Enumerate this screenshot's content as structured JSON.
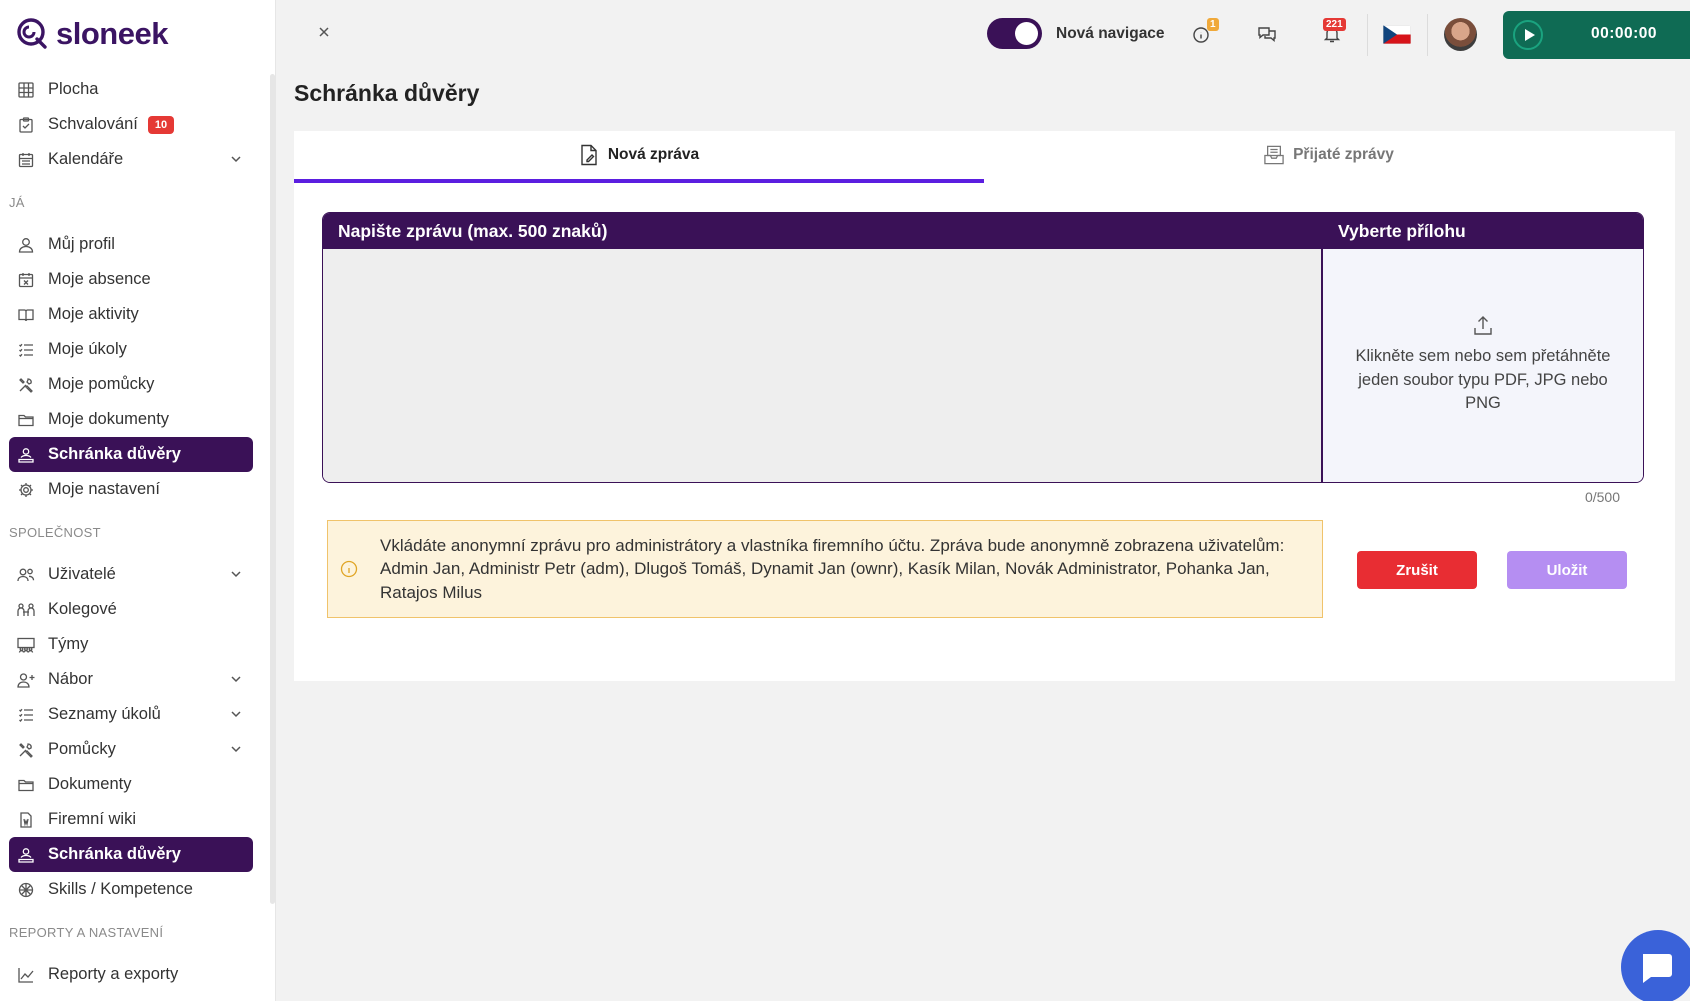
{
  "brand": {
    "name": "sloneek"
  },
  "sidebar": {
    "top_items": [
      {
        "label": "Plocha",
        "icon": "grid-icon"
      },
      {
        "label": "Schvalování",
        "icon": "clipboard-check-icon",
        "badge": "10"
      },
      {
        "label": "Kalendáře",
        "icon": "calendar-icon",
        "expandable": true
      }
    ],
    "section_me": "JÁ",
    "me_items": [
      {
        "label": "Můj profil",
        "icon": "user-icon"
      },
      {
        "label": "Moje absence",
        "icon": "calendar-x-icon"
      },
      {
        "label": "Moje aktivity",
        "icon": "book-icon"
      },
      {
        "label": "Moje úkoly",
        "icon": "checklist-icon"
      },
      {
        "label": "Moje pomůcky",
        "icon": "tools-icon"
      },
      {
        "label": "Moje dokumenty",
        "icon": "folder-icon"
      },
      {
        "label": "Schránka důvěry",
        "icon": "trust-box-icon",
        "active": true
      },
      {
        "label": "Moje nastavení",
        "icon": "gear-icon"
      }
    ],
    "section_company": "SPOLEČNOST",
    "company_items": [
      {
        "label": "Uživatelé",
        "icon": "users-icon",
        "expandable": true
      },
      {
        "label": "Kolegové",
        "icon": "colleagues-icon"
      },
      {
        "label": "Týmy",
        "icon": "teams-icon"
      },
      {
        "label": "Nábor",
        "icon": "user-plus-icon",
        "expandable": true
      },
      {
        "label": "Seznamy úkolů",
        "icon": "checklist-icon",
        "expandable": true
      },
      {
        "label": "Pomůcky",
        "icon": "tools-icon",
        "expandable": true
      },
      {
        "label": "Dokumenty",
        "icon": "folder-icon"
      },
      {
        "label": "Firemní wiki",
        "icon": "wiki-icon"
      },
      {
        "label": "Schránka důvěry",
        "icon": "trust-box-icon",
        "active": true
      },
      {
        "label": "Skills / Kompetence",
        "icon": "skills-icon"
      }
    ],
    "section_reports": "REPORTY A NASTAVENÍ",
    "reports_items": [
      {
        "label": "Reporty a exporty",
        "icon": "chart-icon"
      }
    ]
  },
  "topbar": {
    "toggle_label": "Nová navigace",
    "toggle_on": true,
    "info_badge": "1",
    "notif_badge": "221",
    "timer": "00:00:00"
  },
  "page": {
    "title": "Schránka důvěry",
    "tabs": [
      {
        "label": "Nová zpráva",
        "active": true
      },
      {
        "label": "Přijaté zprávy",
        "active": false
      }
    ],
    "message_header": "Napište zprávu (max. 500 znaků)",
    "message_value": "",
    "counter": "0/500",
    "attach_header": "Vyberte přílohu",
    "attach_text": "Klikněte sem nebo sem přetáhněte jeden soubor typu PDF, JPG nebo PNG",
    "notice": "Vkládáte anonymní zprávu pro administrátory a vlastníka firemního účtu. Zpráva bude anonymně zobrazena uživatelům: Admin Jan, Administr Petr (adm), Dlugoš Tomáš, Dynamit Jan (ownr), Kasík Milan, Novák Administrator, Pohanka Jan, Ratajos Milus",
    "cancel_label": "Zrušit",
    "save_label": "Uložit"
  },
  "colors": {
    "brand_purple": "#3a1157",
    "tab_underline": "#5b1ee0",
    "timer_green": "#0f6b54",
    "cancel_red": "#e82d33",
    "save_disabled": "#b58ef2",
    "notice_bg": "#fdf3dc"
  }
}
